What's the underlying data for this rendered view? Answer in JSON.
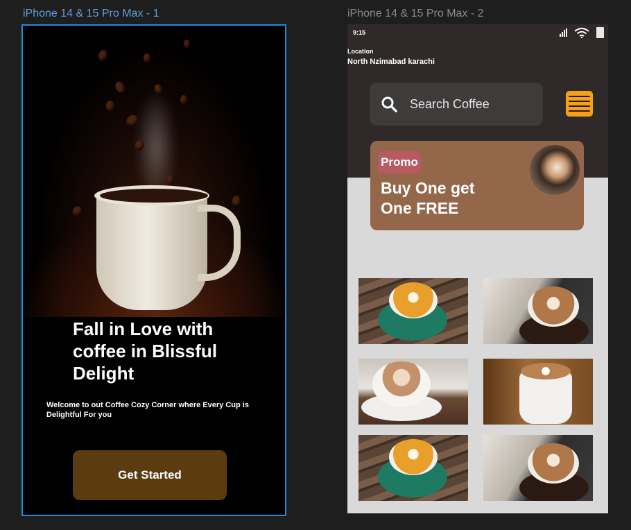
{
  "frame1": {
    "label": "iPhone 14 & 15 Pro Max - 1",
    "title": "Fall in Love with coffee in Blissful Delight",
    "description": "Welcome to out Coffee Cozy Corner where Every Cup is Delightful For you",
    "cta_label": "Get  Started"
  },
  "frame2": {
    "label": "iPhone 14 & 15 Pro Max - 2",
    "status_time": "9:15",
    "location_label": "Location",
    "location_value": "North Nzimabad  karachi",
    "search_placeholder": "Search Coffee",
    "promo_badge": "Promo",
    "promo_text": "Buy One get One FREE",
    "colors": {
      "menu_button": "#f6a01a",
      "promo_card": "#94674b",
      "promo_badge": "#b75a63",
      "cta_button": "#5a3c10"
    },
    "products": [
      "latte-art-green-cup",
      "cappuccino-dark-table",
      "latte-white-cup",
      "flat-white-mug",
      "latte-art-green-cup",
      "cappuccino-dark-table"
    ]
  }
}
